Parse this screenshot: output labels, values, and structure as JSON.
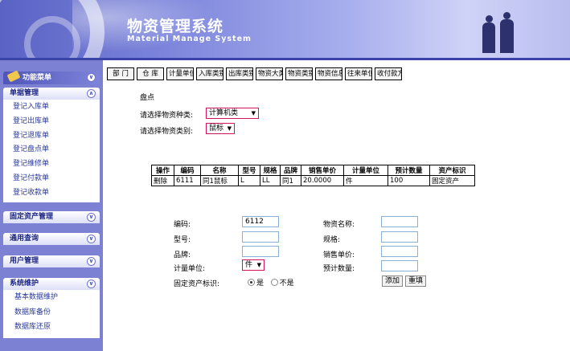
{
  "header": {
    "title": "物资管理系统",
    "subtitle": "Material Manage System"
  },
  "sidebar": {
    "menu_title": "功能菜单",
    "groups": [
      {
        "label": "单据管理",
        "items": [
          "登记入库单",
          "登记出库单",
          "登记退库单",
          "登记盘点单",
          "登记维修单",
          "登记付款单",
          "登记收款单"
        ]
      },
      {
        "label": "固定资产管理",
        "items": []
      },
      {
        "label": "通用查询",
        "items": []
      },
      {
        "label": "用户管理",
        "items": []
      },
      {
        "label": "系统维护",
        "items": [
          "基本数据维护",
          "数据库备份",
          "数据库还原"
        ]
      }
    ]
  },
  "tabs": [
    "部 门",
    "仓 库",
    "计量单位",
    "入库类别",
    "出库类别",
    "物资大类",
    "物资类别",
    "物资信息",
    "往来单位",
    "收付款方"
  ],
  "section_title": "盘点",
  "filters": {
    "category_label": "请选择物资种类:",
    "category_value": "计算机类",
    "type_label": "请选择物资类别:",
    "type_value": "鼠标"
  },
  "table": {
    "headers": [
      "操作",
      "编码",
      "名称",
      "型号",
      "规格",
      "品牌",
      "销售单价",
      "计量单位",
      "预计数量",
      "资产标识"
    ],
    "rows": [
      [
        "删除",
        "6111",
        "同1鼠标",
        "L",
        "LL",
        "同1",
        "20.0000",
        "件",
        "100",
        "固定资产"
      ]
    ]
  },
  "form": {
    "code_label": "编码:",
    "code_value": "6112",
    "name_label": "物资名称:",
    "model_label": "型号:",
    "spec_label": "规格:",
    "brand_label": "品牌:",
    "price_label": "销售单价:",
    "unit_label": "计量单位:",
    "unit_value": "件",
    "qty_label": "预计数量:",
    "asset_label": "固定资产标识:",
    "radio_yes": "是",
    "radio_no": "不是",
    "add_button": "添加",
    "rewrite_button": "重填"
  },
  "colors": {
    "accent": "#3a43a8",
    "sidebar_bg": "#7c81d4",
    "select_border": "#d4145a"
  }
}
